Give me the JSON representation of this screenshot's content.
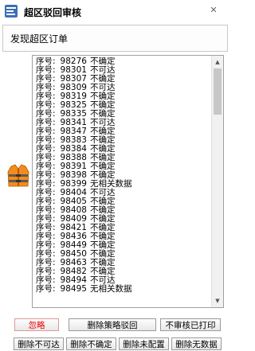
{
  "window": {
    "title": "超区驳回审核",
    "subtitle": "发现超区订单"
  },
  "list": {
    "label": "序号:",
    "items": [
      {
        "no": "98276",
        "status": "不确定"
      },
      {
        "no": "98301",
        "status": "不可达"
      },
      {
        "no": "98307",
        "status": "不确定"
      },
      {
        "no": "98309",
        "status": "不可达"
      },
      {
        "no": "98319",
        "status": "不确定"
      },
      {
        "no": "98325",
        "status": "不确定"
      },
      {
        "no": "98335",
        "status": "不确定"
      },
      {
        "no": "98341",
        "status": "不可达"
      },
      {
        "no": "98347",
        "status": "不确定"
      },
      {
        "no": "98383",
        "status": "不确定"
      },
      {
        "no": "98384",
        "status": "不确定"
      },
      {
        "no": "98388",
        "status": "不确定"
      },
      {
        "no": "98391",
        "status": "不确定"
      },
      {
        "no": "98398",
        "status": "不确定"
      },
      {
        "no": "98399",
        "status": "无相关数据"
      },
      {
        "no": "98404",
        "status": "不可达"
      },
      {
        "no": "98405",
        "status": "不确定"
      },
      {
        "no": "98408",
        "status": "不确定"
      },
      {
        "no": "98409",
        "status": "不确定"
      },
      {
        "no": "98421",
        "status": "不确定"
      },
      {
        "no": "98436",
        "status": "不确定"
      },
      {
        "no": "98449",
        "status": "不确定"
      },
      {
        "no": "98450",
        "status": "不确定"
      },
      {
        "no": "98463",
        "status": "不确定"
      },
      {
        "no": "98482",
        "status": "不确定"
      },
      {
        "no": "98494",
        "status": "不可达"
      },
      {
        "no": "98495",
        "status": "无相关数据"
      }
    ]
  },
  "buttons": {
    "ignore": "忽略",
    "delete_strategy_reject": "删除策略驳回",
    "no_audit_printed": "不审核已打印",
    "delete_unreachable": "删除不可达",
    "delete_uncertain": "删除不确定",
    "delete_unconfigured": "删除未配置",
    "delete_no_data": "删除无数据"
  },
  "colors": {
    "ignore_button_text": "#ee0000"
  }
}
